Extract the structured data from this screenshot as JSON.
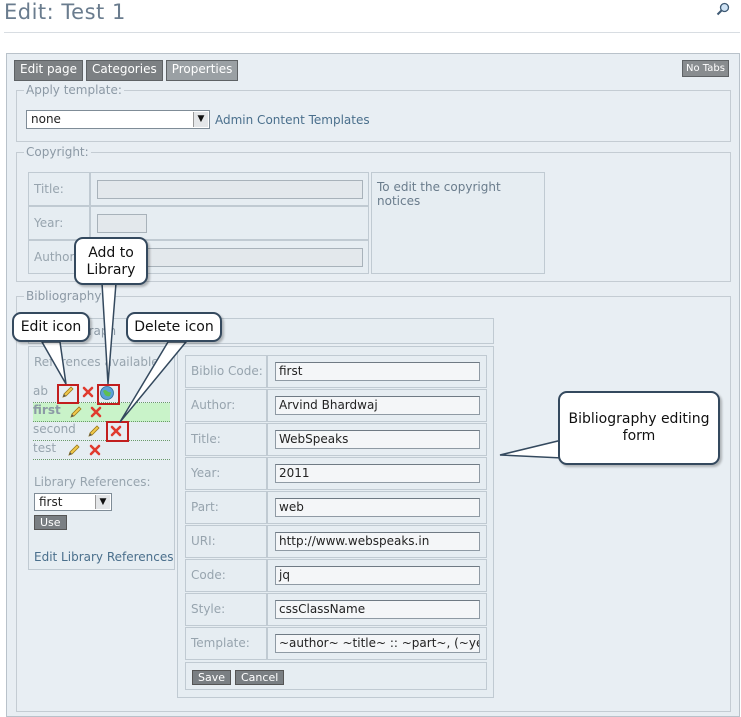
{
  "page": {
    "title": "Edit: Test 1"
  },
  "tabs": [
    "Edit page",
    "Categories",
    "Properties"
  ],
  "no_tabs": "No Tabs",
  "apply_template": {
    "legend": "Apply template:",
    "selected": "none",
    "link": "Admin Content Templates"
  },
  "copyright": {
    "legend": "Copyright:",
    "labels": [
      "Title:",
      "Year:",
      "Author"
    ],
    "note": "To edit the copyright notices"
  },
  "bibliography": {
    "legend": "Bibliography",
    "sub_label": "graph",
    "refs_label": "References available:",
    "refs": [
      {
        "name": "ab"
      },
      {
        "name": "first"
      },
      {
        "name": "second"
      },
      {
        "name": "test"
      }
    ],
    "lib_label": "Library References:",
    "lib_selected": "first",
    "use_label": "Use",
    "edit_lib_link": "Edit Library References"
  },
  "form": {
    "rows": [
      {
        "label": "Biblio Code:",
        "value": "first"
      },
      {
        "label": "Author:",
        "value": "Arvind Bhardwaj"
      },
      {
        "label": "Title:",
        "value": "WebSpeaks"
      },
      {
        "label": "Year:",
        "value": "2011"
      },
      {
        "label": "Part:",
        "value": "web"
      },
      {
        "label": "URI:",
        "value": "http://www.webspeaks.in"
      },
      {
        "label": "Code:",
        "value": "jq"
      },
      {
        "label": "Style:",
        "value": "cssClassName"
      },
      {
        "label": "Template:",
        "value": "~author~ ~title~ :: ~part~, (~year~"
      }
    ],
    "save": "Save",
    "cancel": "Cancel"
  },
  "callouts": {
    "edit_icon": "Edit icon",
    "add_library": "Add to Library",
    "delete_icon": "Delete icon",
    "form": "Bibliography editing form"
  },
  "colors": {
    "accent_red": "#c21e1e",
    "callout_border": "#34495e",
    "row_highlight": "#c9f3c9"
  }
}
